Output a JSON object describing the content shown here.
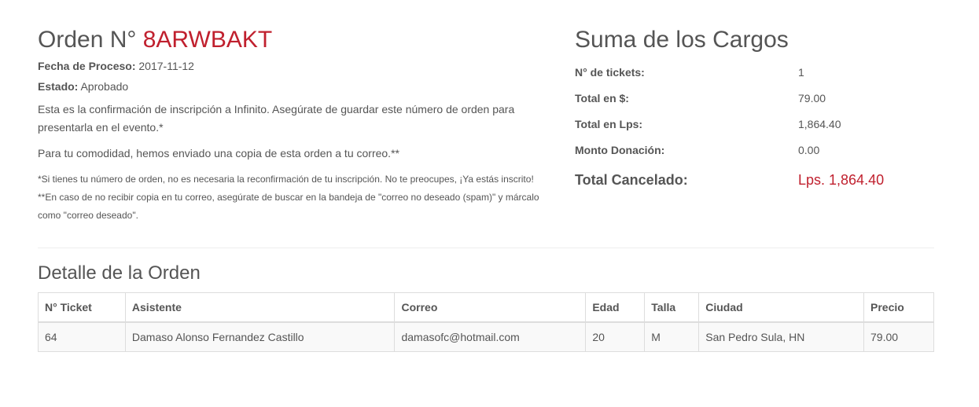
{
  "order": {
    "title_prefix": "Orden N°",
    "number": "8ARWBAKT",
    "process_date_label": "Fecha de Proceso:",
    "process_date": "2017-11-12",
    "status_label": "Estado:",
    "status": "Aprobado",
    "message_1": "Esta es la confirmación de inscripción a Infinito. Asegúrate de guardar este número de orden para presentarla en el evento.*",
    "message_2": "Para tu comodidad, hemos enviado una copia de esta orden a tu correo.**",
    "note_1": "*Si tienes tu número de orden, no es necesaria la reconfirmación de tu inscripción. No te preocupes, ¡Ya estás inscrito!",
    "note_2": "**En caso de no recibir copia en tu correo, asegúrate de buscar en la bandeja de \"correo no deseado (spam)\" y márcalo como \"correo deseado\"."
  },
  "summary": {
    "title": "Suma de los Cargos",
    "rows": [
      {
        "label": "N° de tickets:",
        "value": "1"
      },
      {
        "label": "Total en $:",
        "value": "79.00"
      },
      {
        "label": "Total en Lps:",
        "value": "1,864.40"
      },
      {
        "label": "Monto Donación:",
        "value": "0.00"
      }
    ],
    "total_label": "Total Cancelado:",
    "total_value": "Lps. 1,864.40"
  },
  "detail": {
    "title": "Detalle de la Orden",
    "headers": [
      "N° Ticket",
      "Asistente",
      "Correo",
      "Edad",
      "Talla",
      "Ciudad",
      "Precio"
    ],
    "rows": [
      [
        "64",
        "Damaso Alonso Fernandez Castillo",
        "damasofc@hotmail.com",
        "20",
        "M",
        "San Pedro Sula, HN",
        "79.00"
      ]
    ]
  },
  "colors": {
    "accent": "#c0202e",
    "text": "#555555",
    "border": "#dddddd",
    "row_bg": "#f9f9f9"
  }
}
